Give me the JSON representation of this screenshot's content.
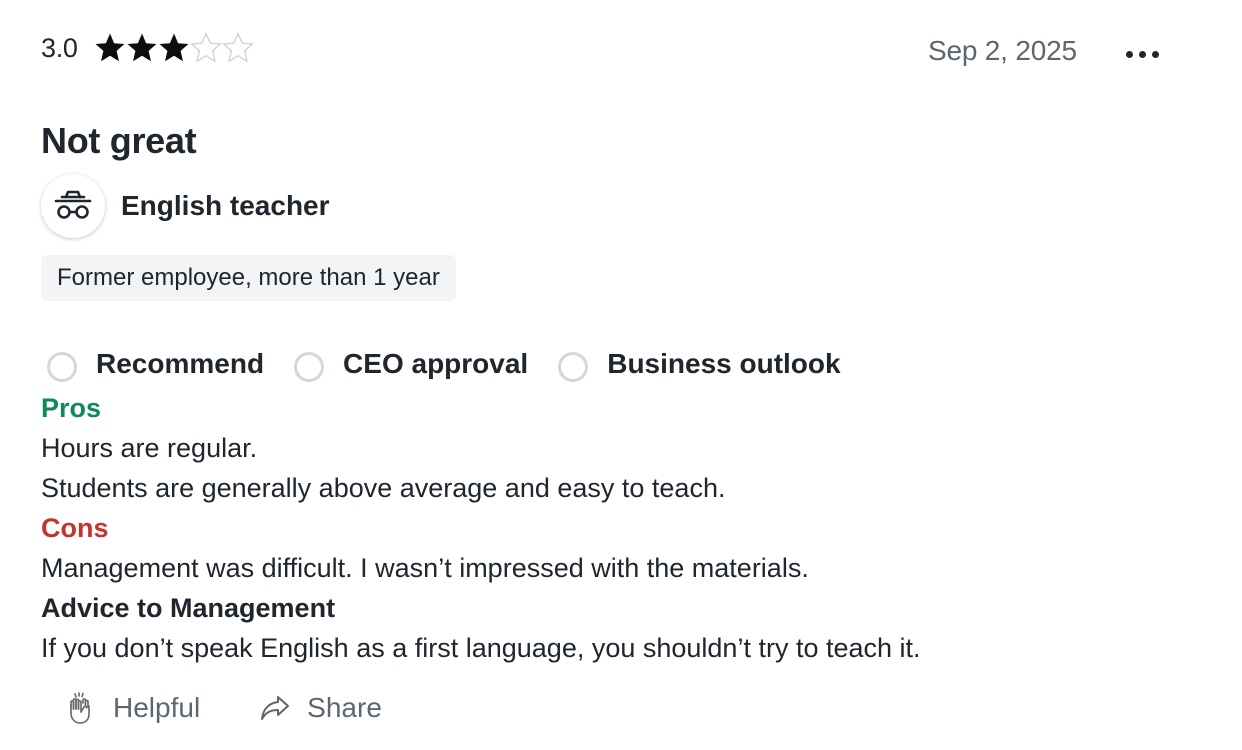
{
  "review": {
    "rating_value": "3.0",
    "rating_stars": 3,
    "rating_max": 5,
    "date": "Sep 2, 2025",
    "title": "Not great",
    "job_title": "English teacher",
    "tenure": "Former employee, more than 1 year"
  },
  "ratings": {
    "recommend": "Recommend",
    "ceo_approval": "CEO approval",
    "business_outlook": "Business outlook"
  },
  "pros": {
    "heading": "Pros",
    "lines": [
      "Hours are regular.",
      "Students are generally above average and easy to teach."
    ]
  },
  "cons": {
    "heading": "Cons",
    "lines": [
      "Management was difficult. I wasn’t impressed with the materials."
    ]
  },
  "advice": {
    "heading": "Advice to Management",
    "lines": [
      "If you don’t speak English as a first language, you shouldn’t try to teach it."
    ]
  },
  "actions": {
    "helpful": "Helpful",
    "share": "Share"
  },
  "icons": {
    "star_filled": "star-icon",
    "star_empty": "star-outline-icon",
    "more": "more-options-icon",
    "avatar": "anonymous-spy-icon",
    "helpful": "clapping-hands-icon",
    "share": "share-arrow-icon"
  },
  "colors": {
    "text": "#20262e",
    "muted": "#5e666f",
    "pros": "#0e8a56",
    "cons": "#c8322e",
    "badge_bg": "#f3f4f5",
    "circle_border": "#d4d6d8"
  }
}
